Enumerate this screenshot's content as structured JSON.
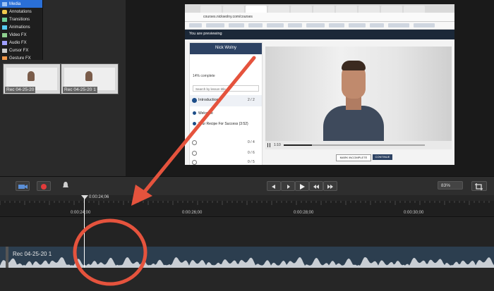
{
  "left_panel": {
    "items": [
      {
        "label": "Media",
        "icon": "media-icon",
        "selected": true
      },
      {
        "label": "Annotations",
        "icon": "annotations-icon"
      },
      {
        "label": "Transitions",
        "icon": "transitions-icon"
      },
      {
        "label": "Animations",
        "icon": "animations-icon"
      },
      {
        "label": "Video FX",
        "icon": "video-fx-icon"
      },
      {
        "label": "Audio FX",
        "icon": "audio-fx-icon"
      },
      {
        "label": "Cursor FX",
        "icon": "cursor-fx-icon"
      },
      {
        "label": "Gesture FX",
        "icon": "gesture-fx-icon"
      }
    ]
  },
  "media_bin": {
    "clips": [
      {
        "label": "Rec 04-25-20"
      },
      {
        "label": "Rec 04-25-20 1"
      }
    ]
  },
  "canvas": {
    "url": "courses.nickwolny.com/courses",
    "notice": "You are previewing",
    "course_name": "Nick Wolny",
    "course_progress": "14% complete",
    "search_placeholder": "Search by lesson title",
    "section_title": "Introduction",
    "section_count": "2 / 2",
    "lesson_1_title": "Welcome",
    "lesson_2_title": "Your Recipe For Success (3:52)",
    "count_2": "0 / 4",
    "count_3": "0 / 6",
    "count_4": "0 / 5",
    "video_time": "1:10",
    "prev_button": "MARK INCOMPLETE",
    "next_button": "CONTINUE"
  },
  "toolbar": {
    "zoom": "83%",
    "play_icon": "play-icon",
    "prev_icon": "step-back-icon",
    "next_icon": "step-forward-icon"
  },
  "timeline": {
    "playhead_time": "0:00:24;06",
    "ruler_labels": [
      "0:00:24;00",
      "0:00:26;00",
      "0:00:28;00",
      "0:00:30;00"
    ],
    "track_label": "Rec 04-25-20 1"
  },
  "colors": {
    "accent": "#2a6fd6",
    "annotation_red": "#e5533d",
    "track": "#2c3e4f"
  }
}
